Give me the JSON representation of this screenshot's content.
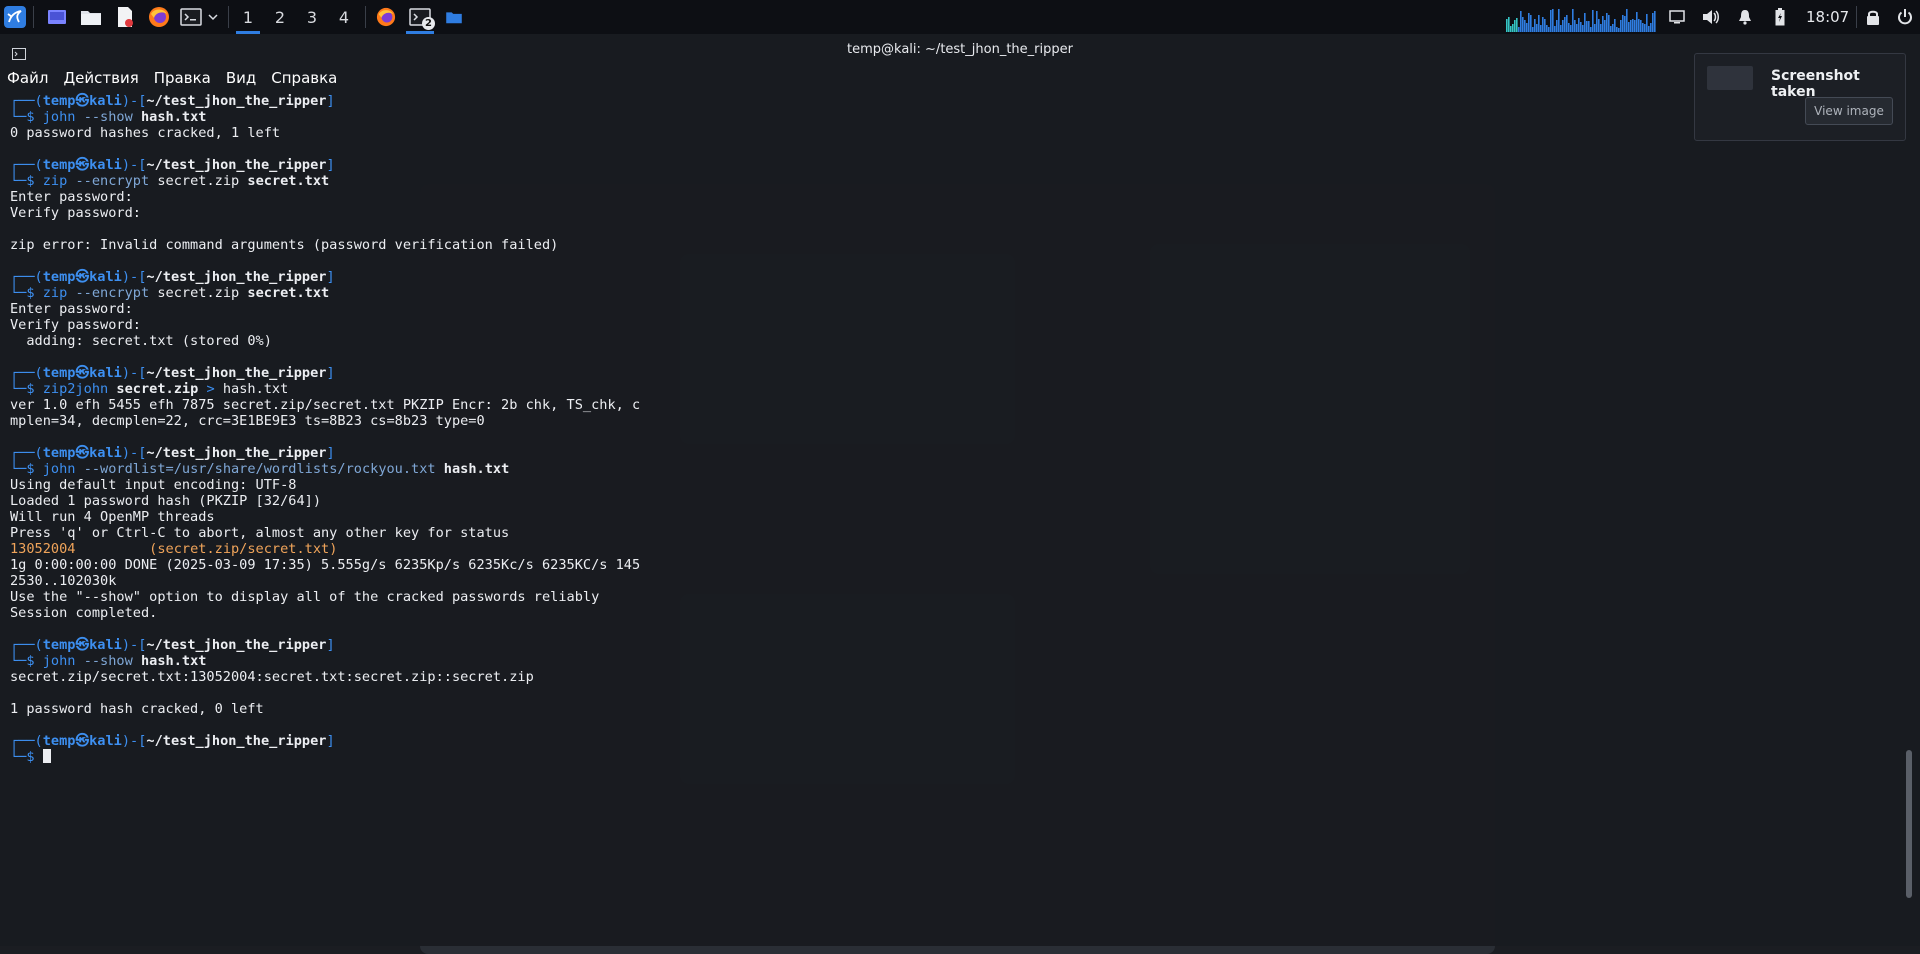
{
  "panel": {
    "workspaces": [
      "1",
      "2",
      "3",
      "4"
    ],
    "active_workspace": "1",
    "terminal_badge": "2",
    "clock": "18:07",
    "accent_color": "#2f7de1"
  },
  "terminal": {
    "title": "temp@kali: ~/test_jhon_the_ripper",
    "menu": [
      "Файл",
      "Действия",
      "Правка",
      "Вид",
      "Справка"
    ],
    "prompt": {
      "user": "temp",
      "host": "kali",
      "path": "~/test_jhon_the_ripper"
    },
    "blocks": [
      {
        "cmd": "john",
        "args": "--show",
        "file": "hash.txt",
        "output": [
          "0 password hashes cracked, 1 left"
        ]
      },
      {
        "cmd": "zip",
        "args": "--encrypt",
        "mid": "secret.zip",
        "file": "secret.txt",
        "output": [
          "Enter password:",
          "Verify password:",
          "",
          "zip error: Invalid command arguments (password verification failed)"
        ]
      },
      {
        "cmd": "zip",
        "args": "--encrypt",
        "mid": "secret.zip",
        "file": "secret.txt",
        "output": [
          "Enter password:",
          "Verify password:",
          "  adding: secret.txt (stored 0%)"
        ]
      },
      {
        "cmd": "zip2john",
        "file": "secret.zip",
        "redirect": ">",
        "tail": "hash.txt",
        "output": [
          "ver 1.0 efh 5455 efh 7875 secret.zip/secret.txt PKZIP Encr: 2b chk, TS_chk, c",
          "mplen=34, decmplen=22, crc=3E1BE9E3 ts=8B23 cs=8b23 type=0"
        ]
      },
      {
        "cmd": "john",
        "args": "--wordlist=/usr/share/wordlists/rockyou.txt",
        "file": "hash.txt",
        "output": [
          "Using default input encoding: UTF-8",
          "Loaded 1 password hash (PKZIP [32/64])",
          "Will run 4 OpenMP threads",
          "Press 'q' or Ctrl-C to abort, almost any other key for status"
        ],
        "cracked_password": "13052004",
        "cracked_file": "(secret.zip/secret.txt)",
        "output2": [
          "1g 0:00:00:00 DONE (2025-03-09 17:35) 5.555g/s 6235Kp/s 6235Kc/s 6235KC/s 145",
          "2530..102030k",
          "Use the \"--show\" option to display all of the cracked passwords reliably",
          "Session completed."
        ]
      },
      {
        "cmd": "john",
        "args": "--show",
        "file": "hash.txt",
        "output": [
          "secret.zip/secret.txt:13052004:secret.txt:secret.zip::secret.zip",
          "",
          "1 password hash cracked, 0 left"
        ]
      }
    ]
  },
  "notification": {
    "title": "Screenshot taken",
    "button": "View image"
  }
}
